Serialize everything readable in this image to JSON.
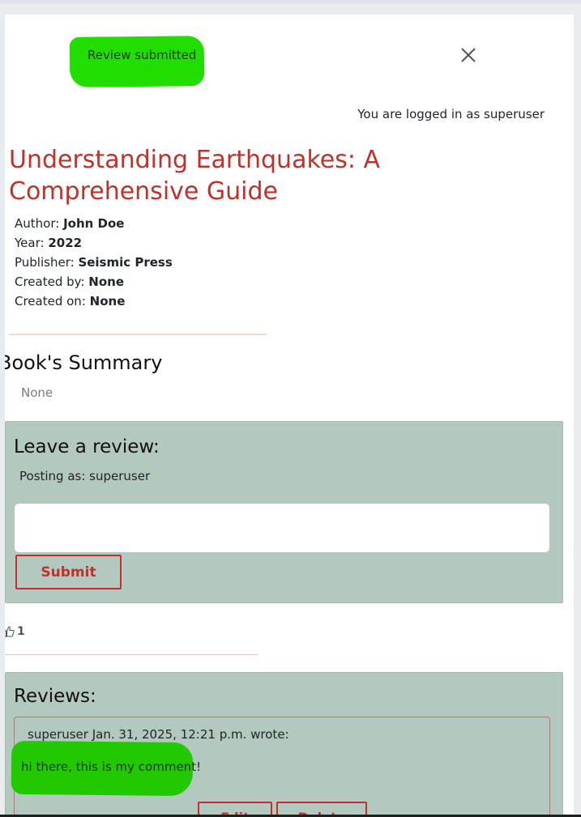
{
  "alert": {
    "message": "Review submitted"
  },
  "header": {
    "login_status": "You are logged in as superuser"
  },
  "book": {
    "title": "Understanding Earthquakes: A Comprehensive Guide",
    "author_label": "Author:",
    "author": "John Doe",
    "year_label": "Year:",
    "year": "2022",
    "publisher_label": "Publisher:",
    "publisher": "Seismic Press",
    "created_by_label": "Created by:",
    "created_by": "None",
    "created_on_label": "Created on:",
    "created_on": "None"
  },
  "summary": {
    "heading": "Book's Summary",
    "text": "None"
  },
  "review_form": {
    "heading": "Leave a review:",
    "posting_as": "Posting as: superuser",
    "input_value": "",
    "submit_label": "Submit"
  },
  "likes": {
    "count": "1"
  },
  "reviews": {
    "heading": "Reviews:",
    "items": [
      {
        "meta": "superuser Jan. 31, 2025, 12:21 p.m. wrote:",
        "body": "hi there, this is my comment!",
        "edit_label": "Edit",
        "delete_label": "Delete"
      }
    ]
  },
  "colors": {
    "accent": "#c0312b",
    "card_background": "#b3c8bf",
    "highlight": "#22dd00"
  }
}
